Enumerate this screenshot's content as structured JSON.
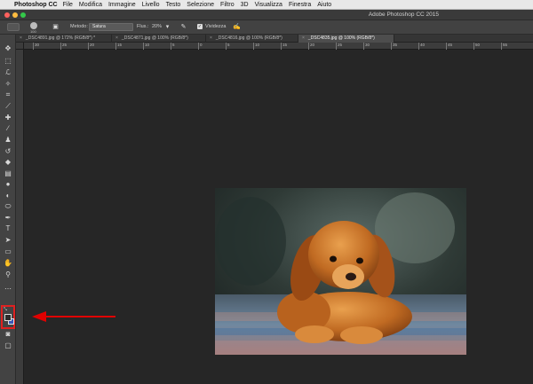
{
  "menubar": {
    "app_name": "Photoshop CC",
    "items": [
      "File",
      "Modifica",
      "Immagine",
      "Livello",
      "Testo",
      "Selezione",
      "Filtro",
      "3D",
      "Visualizza",
      "Finestra",
      "Aiuto"
    ]
  },
  "window": {
    "title": "Adobe Photoshop CC 2015"
  },
  "options": {
    "brush_size": "100",
    "method_label": "Metodo:",
    "method_value": "Satura",
    "flow_label": "Flus.:",
    "flow_value": "20%",
    "vibrance_label": "Vividezza",
    "vibrance_checked": true
  },
  "tabs": [
    {
      "label": "_DSC4891.jpg @ 172% (RGB/8*) *",
      "active": false
    },
    {
      "label": "_DSC4871.jpg @ 100% (RGB/8*)",
      "active": false
    },
    {
      "label": "_DSC4816.jpg @ 100% (RGB/8*)",
      "active": false
    },
    {
      "label": "_DSC4835.jpg @ 100% (RGB/8*)",
      "active": true
    }
  ],
  "ruler": {
    "labels": [
      "30",
      "25",
      "20",
      "15",
      "10",
      "5",
      "0",
      "5",
      "10",
      "15",
      "20",
      "25",
      "30",
      "35",
      "40",
      "45",
      "50",
      "55"
    ]
  },
  "tools": [
    "move-icon",
    "marquee-icon",
    "lasso-icon",
    "quick-select-icon",
    "crop-icon",
    "eyedropper-icon",
    "healing-icon",
    "brush-icon",
    "stamp-icon",
    "history-brush-icon",
    "eraser-icon",
    "gradient-icon",
    "blur-icon",
    "dodge-icon",
    "sponge-icon",
    "pen-icon",
    "type-icon",
    "path-select-icon",
    "shape-icon",
    "hand-icon",
    "zoom-icon",
    "more-icon"
  ],
  "colors": {
    "foreground": "#2b2b2b",
    "background": "#3a56b8",
    "highlight": "#e02020"
  }
}
